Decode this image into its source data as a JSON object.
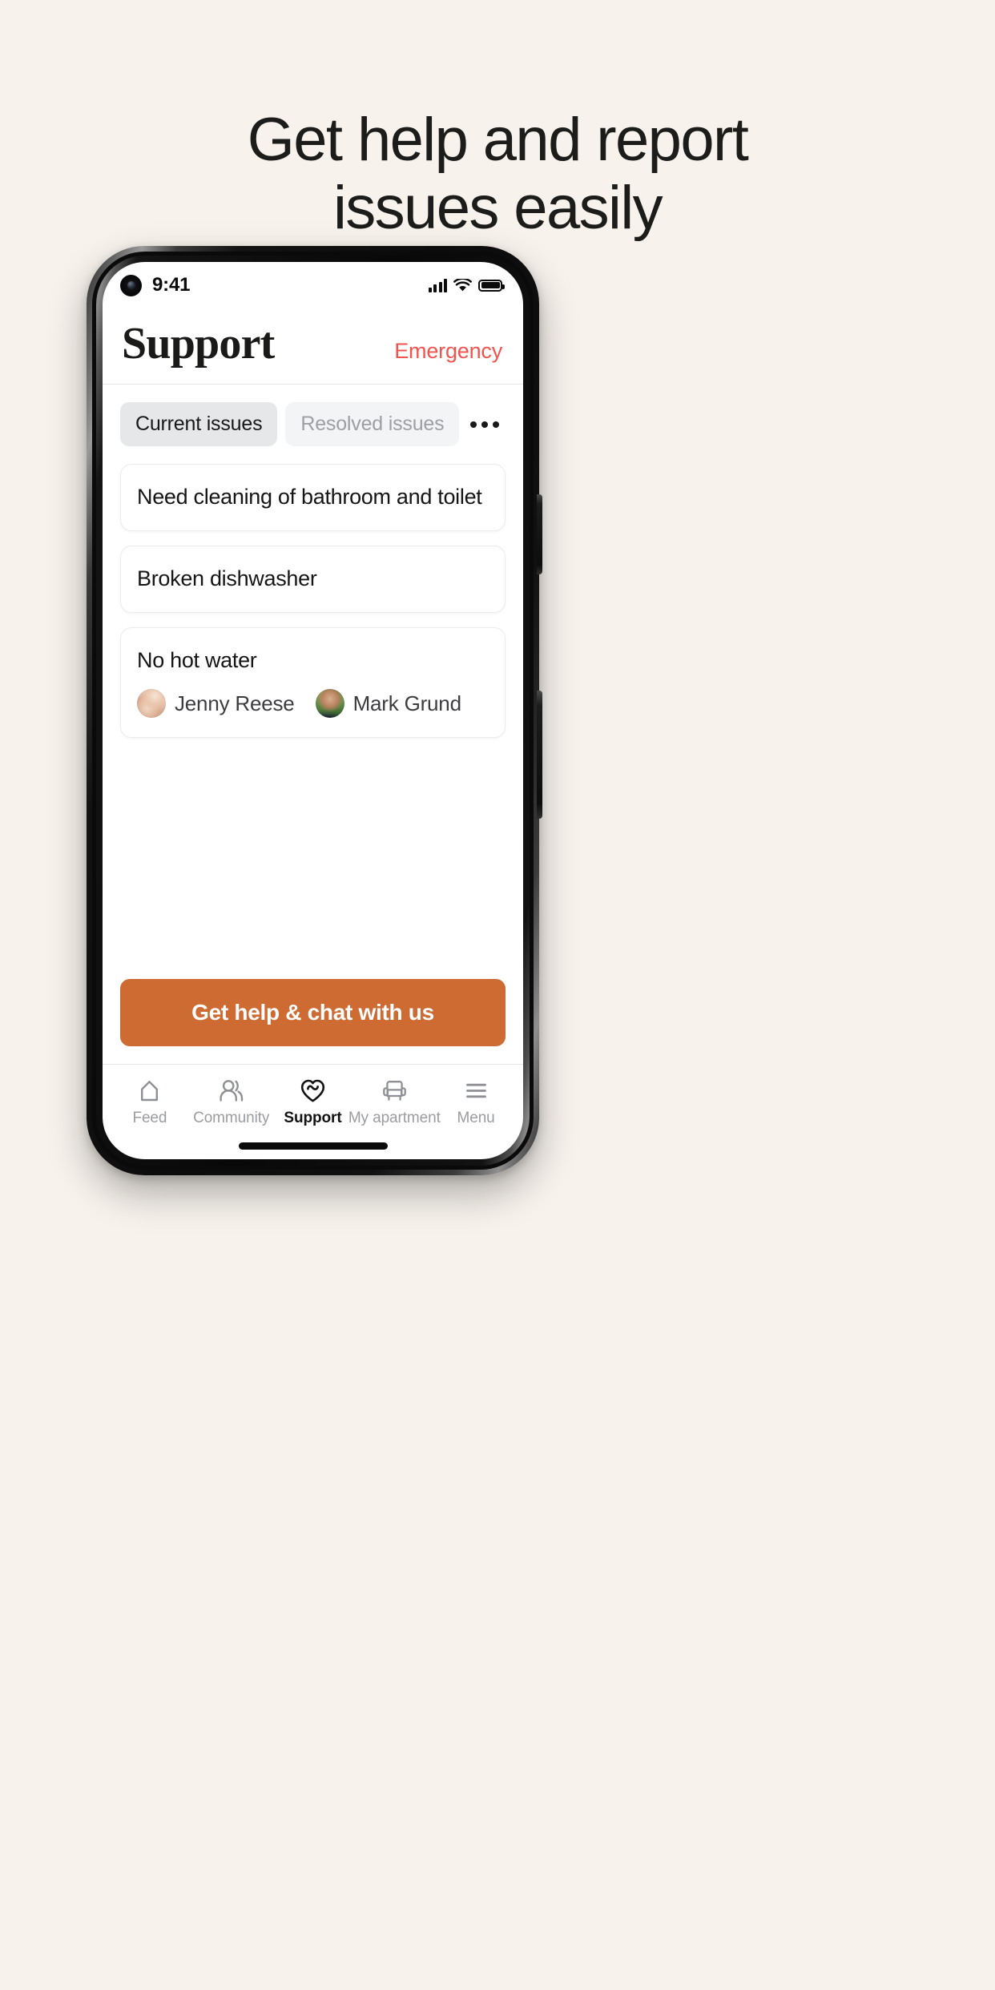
{
  "headline": {
    "line1": "Get help and report",
    "line2": "issues easily"
  },
  "colors": {
    "page_background": "#F7F2EC",
    "accent_orange": "#CD6B33",
    "emergency_red": "#F0544F",
    "active_chip_bg": "#E6E7E9",
    "inactive_chip_bg": "#F3F4F5",
    "text_primary": "#151517",
    "text_muted": "#9A9CA1"
  },
  "status_bar": {
    "time": "9:41",
    "camera_icon": "punch-hole-camera-icon",
    "signal_icon": "cellular-signal-icon",
    "wifi_icon": "wifi-icon",
    "battery_icon": "battery-full-icon"
  },
  "app_header": {
    "title": "Support",
    "emergency_label": "Emergency"
  },
  "tabs": {
    "items": [
      {
        "label": "Current issues",
        "active": true
      },
      {
        "label": "Resolved issues",
        "active": false
      }
    ],
    "overflow_icon": "more-horizontal-icon"
  },
  "issues": [
    {
      "title": "Need cleaning of bathroom and toilet",
      "assignees": []
    },
    {
      "title": "Broken dishwasher",
      "assignees": []
    },
    {
      "title": "No hot water",
      "assignees": [
        {
          "name": "Jenny Reese",
          "avatar": "av-jenny"
        },
        {
          "name": "Mark Grund",
          "avatar": "av-mark"
        }
      ]
    }
  ],
  "cta": {
    "label": "Get help & chat with us"
  },
  "bottom_nav": {
    "items": [
      {
        "label": "Feed",
        "icon": "home-icon",
        "active": false
      },
      {
        "label": "Community",
        "icon": "people-icon",
        "active": false
      },
      {
        "label": "Support",
        "icon": "heart-icon",
        "active": true
      },
      {
        "label": "My apartment",
        "icon": "armchair-icon",
        "active": false
      },
      {
        "label": "Menu",
        "icon": "hamburger-icon",
        "active": false
      }
    ]
  },
  "home_indicator": "home-indicator-bar"
}
